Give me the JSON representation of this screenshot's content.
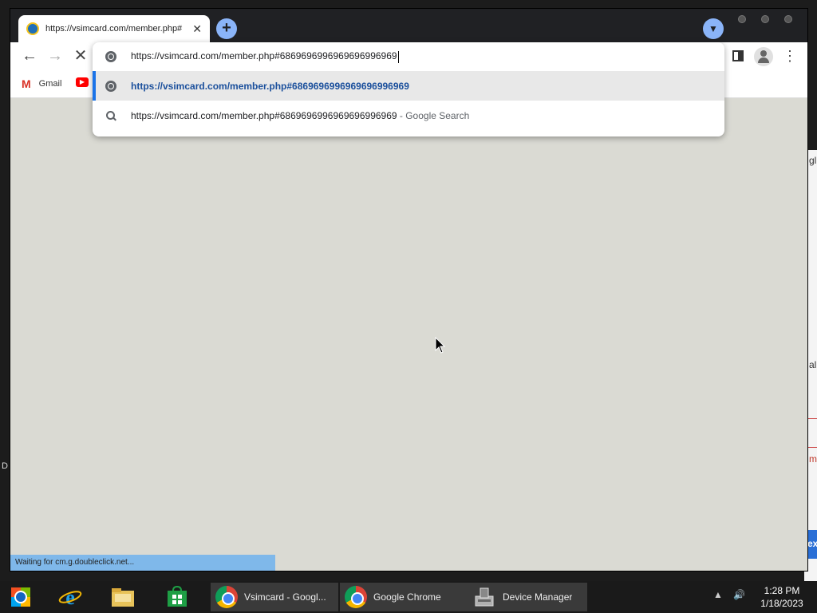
{
  "browser": {
    "tab": {
      "title": "https://vsimcard.com/member.php#"
    },
    "omnibox": {
      "value": "https://vsimcard.com/member.php#6869696996969696996969",
      "suggestions": [
        {
          "text": "https://vsimcard.com/member.php#6869696996969696996969",
          "suffix": "",
          "icon": "globe-icon"
        },
        {
          "text": "https://vsimcard.com/member.php#6869696996969696996969",
          "suffix": " - Google Search",
          "icon": "search-icon"
        }
      ]
    },
    "bookmarks": [
      {
        "label": "Gmail",
        "icon": "gmail-icon"
      },
      {
        "label": "",
        "icon": "youtube-icon"
      }
    ],
    "status": "Waiting for cm.g.doubleclick.net..."
  },
  "background_window": {
    "fragments": [
      "gl",
      "al",
      "m",
      "ex"
    ]
  },
  "desktop": {
    "edge_letter": "D"
  },
  "taskbar": {
    "buttons": [
      {
        "label": "Vsimcard - Googl...",
        "active": true
      },
      {
        "label": "Google Chrome",
        "active": false
      },
      {
        "label": "Device Manager",
        "active": false
      }
    ],
    "clock": {
      "time": "1:28 PM",
      "date": "1/18/2023"
    }
  },
  "colors": {
    "accent": "#1a73e8",
    "content_bg": "#dadad3",
    "status_bar": "#7fb8ea",
    "taskbar": "#1a1a1a"
  }
}
